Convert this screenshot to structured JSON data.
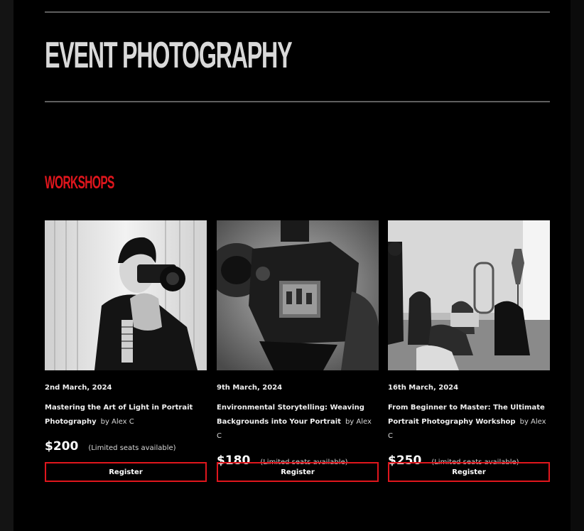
{
  "page": {
    "title": "EVENT PHOTOGRAPHY",
    "section_title": "WORKSHOPS"
  },
  "colors": {
    "accent": "#e0161d",
    "background": "#000000",
    "text": "#e8e8e8"
  },
  "workshops": [
    {
      "date": "2nd March, 2024",
      "title": "Mastering the Art of Light in Portrait Photography",
      "author": "by Alex C",
      "price": "$200",
      "availability": "(Limited seats available)",
      "register_label": "Register"
    },
    {
      "date": "9th March, 2024",
      "title": "Environmental Storytelling: Weaving Backgrounds into Your Portrait",
      "author": "by Alex C",
      "price": "$180",
      "availability": "(Limited seats available)",
      "register_label": "Register"
    },
    {
      "date": "16th March, 2024",
      "title": "From Beginner to Master: The Ultimate Portrait Photography Workshop",
      "author": "by Alex C",
      "price": "$250",
      "availability": "(Limited seats available)",
      "register_label": "Register"
    }
  ]
}
